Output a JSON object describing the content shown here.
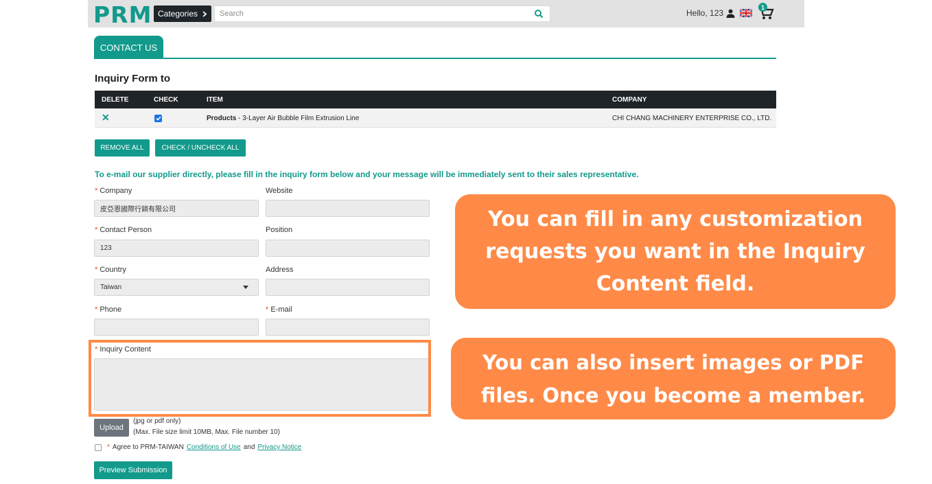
{
  "header": {
    "logo": "PRM",
    "categories_label": "Categories",
    "search_placeholder": "Search",
    "greeting": "Hello, 123",
    "cart_count": "1"
  },
  "tab": {
    "label": "CONTACT US"
  },
  "form_title": "Inquiry Form to",
  "table": {
    "columns": [
      "DELETE",
      "CHECK",
      "ITEM",
      "COMPANY"
    ],
    "rows": [
      {
        "item_category": "Products",
        "item_name": " - 3-Layer Air Bubble Film Extrusion Line",
        "company": "CHI CHANG MACHINERY ENTERPRISE CO., LTD.",
        "checked": true
      }
    ]
  },
  "actions": {
    "remove_all": "REMOVE ALL",
    "check_uncheck_all": "CHECK / UNCHECK ALL"
  },
  "intro_text": "To e-mail our supplier directly, please fill in the inquiry form below and your message will be immediately sent to their sales representative.",
  "fields": {
    "company": {
      "label": "Company",
      "value": "皮亞恩國際行銷有限公司",
      "required": true
    },
    "website": {
      "label": "Website",
      "value": ""
    },
    "contact_person": {
      "label": "Contact Person",
      "value": "123",
      "required": true
    },
    "position": {
      "label": "Position",
      "value": ""
    },
    "country": {
      "label": "Country",
      "value": "Taiwan",
      "required": true
    },
    "address": {
      "label": "Address",
      "value": ""
    },
    "phone": {
      "label": "Phone",
      "value": "",
      "required": true
    },
    "email": {
      "label": "E-mail",
      "value": "",
      "required": true
    },
    "inquiry_content": {
      "label": "Inquiry Content",
      "value": "",
      "required": true
    }
  },
  "upload": {
    "button": "Upload",
    "note1": "(jpg or pdf only)",
    "note2": "(Max. File size limit 10MB, Max. File number 10)"
  },
  "agree": {
    "prefix": "Agree to PRM-TAIWAN",
    "conditions": "Conditions of Use",
    "and": "and",
    "privacy": "Privacy Notice"
  },
  "preview_button": "Preview Submission",
  "callouts": {
    "first": "You can fill in any customization requests you want in the Inquiry Content field.",
    "second": "You can also insert images or PDF files. Once you become a member."
  },
  "colors": {
    "brand_teal": "#129a8c",
    "callout_orange": "#ff8a47",
    "header_dark": "#1f2428"
  }
}
